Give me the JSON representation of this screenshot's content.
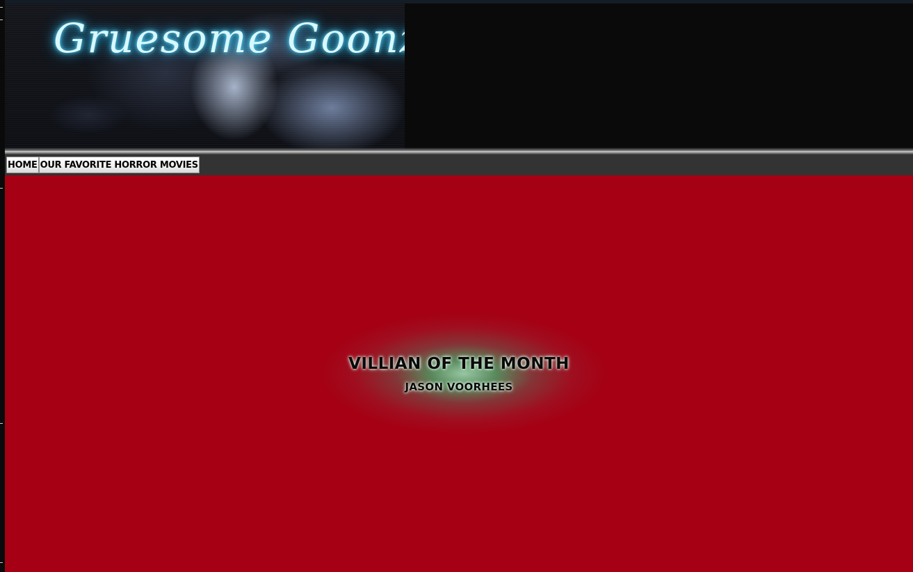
{
  "site": {
    "banner_title": "Gruesome Goonz"
  },
  "nav": {
    "items": [
      {
        "label": "HOME"
      },
      {
        "label": "OUR FAVORITE HORROR MOVIES"
      }
    ]
  },
  "feature": {
    "heading": "VILLIAN OF THE MONTH",
    "name": "JASON VOORHEES"
  },
  "colors": {
    "content_background": "#a50013",
    "navbar_background": "#333333",
    "header_background": "#0a0a0a",
    "title_glow": "#5fe0ff",
    "feature_glow": "#46aa6e"
  }
}
